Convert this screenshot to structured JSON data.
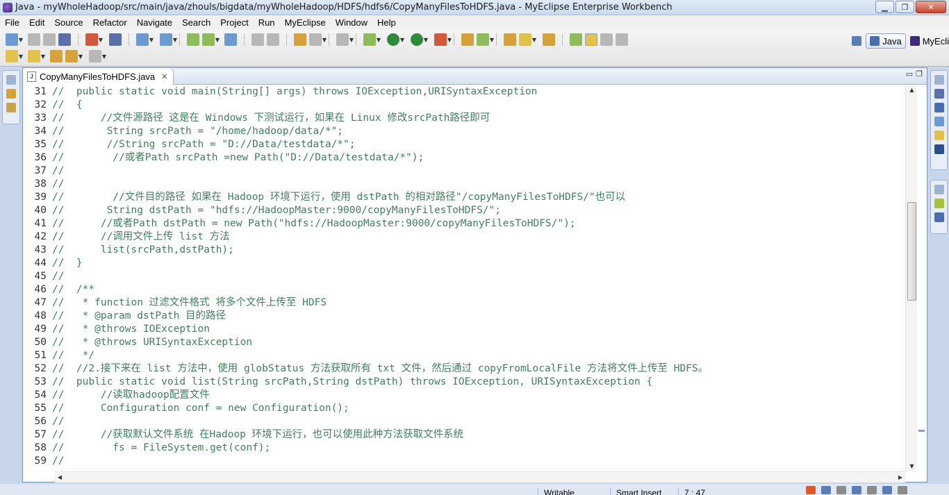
{
  "window": {
    "title": "Java - myWholeHadoop/src/main/java/zhouls/bigdata/myWholeHadoop/HDFS/hdfs6/CopyManyFilesToHDFS.java - MyEclipse Enterprise Workbench",
    "min_glyph": "▁",
    "restore_glyph": "❐",
    "close_glyph": "✕"
  },
  "menubar": {
    "items": [
      "File",
      "Edit",
      "Source",
      "Refactor",
      "Navigate",
      "Search",
      "Project",
      "Run",
      "MyEclipse",
      "Window",
      "Help"
    ]
  },
  "perspectives": {
    "java_label": "Java",
    "myeclipse_label": "MyEcli"
  },
  "editor": {
    "tab_label": "CopyManyFilesToHDFS.java",
    "tab_close": "✕",
    "tab_icon_letter": "J",
    "minimize_glyph": "▭",
    "maximize_glyph": "❐",
    "lines": [
      {
        "n": "31",
        "t": "//  public static void main(String[] args) throws IOException,URISyntaxException"
      },
      {
        "n": "32",
        "t": "//  {"
      },
      {
        "n": "33",
        "t": "//      //文件源路径 这是在 Windows 下测试运行，如果在 Linux 修改srcPath路径即可"
      },
      {
        "n": "34",
        "t": "//       String srcPath = \"/home/hadoop/data/*\";"
      },
      {
        "n": "35",
        "t": "//       //String srcPath = \"D://Data/testdata/*\";"
      },
      {
        "n": "36",
        "t": "//        //或者Path srcPath =new Path(\"D://Data/testdata/*\");"
      },
      {
        "n": "37",
        "t": "//"
      },
      {
        "n": "38",
        "t": "//"
      },
      {
        "n": "39",
        "t": "//        //文件目的路径 如果在 Hadoop 环境下运行，使用 dstPath 的相对路径\"/copyManyFilesToHDFS/\"也可以"
      },
      {
        "n": "40",
        "t": "//       String dstPath = \"hdfs://HadoopMaster:9000/copyManyFilesToHDFS/\";"
      },
      {
        "n": "41",
        "t": "//      //或者Path dstPath = new Path(\"hdfs://HadoopMaster:9000/copyManyFilesToHDFS/\");"
      },
      {
        "n": "42",
        "t": "//      //调用文件上传 list 方法"
      },
      {
        "n": "43",
        "t": "//      list(srcPath,dstPath);"
      },
      {
        "n": "44",
        "t": "//  }"
      },
      {
        "n": "45",
        "t": "//"
      },
      {
        "n": "46",
        "t": "//  /**"
      },
      {
        "n": "47",
        "t": "//   * function 过滤文件格式 将多个文件上传至 HDFS"
      },
      {
        "n": "48",
        "t": "//   * @param dstPath 目的路径"
      },
      {
        "n": "49",
        "t": "//   * @throws IOException"
      },
      {
        "n": "50",
        "t": "//   * @throws URISyntaxException"
      },
      {
        "n": "51",
        "t": "//   */"
      },
      {
        "n": "52",
        "t": "//  //2.接下来在 list 方法中，使用 globStatus 方法获取所有 txt 文件，然后通过 copyFromLocalFile 方法将文件上传至 HDFS。"
      },
      {
        "n": "53",
        "t": "//  public static void list(String srcPath,String dstPath) throws IOException, URISyntaxException {"
      },
      {
        "n": "54",
        "t": "//      //读取hadoop配置文件"
      },
      {
        "n": "55",
        "t": "//      Configuration conf = new Configuration();"
      },
      {
        "n": "56",
        "t": "//"
      },
      {
        "n": "57",
        "t": "//      //获取默认文件系统 在Hadoop 环境下运行，也可以使用此种方法获取文件系统"
      },
      {
        "n": "58",
        "t": "//        fs = FileSystem.get(conf);"
      },
      {
        "n": "59",
        "t": "//"
      }
    ]
  },
  "statusbar": {
    "writable": "Writable",
    "insert_mode": "Smart Insert",
    "position": "7 : 47"
  },
  "colors": {
    "comment_green": "#3f7f5f",
    "frame_blue": "#c7d6ea"
  }
}
